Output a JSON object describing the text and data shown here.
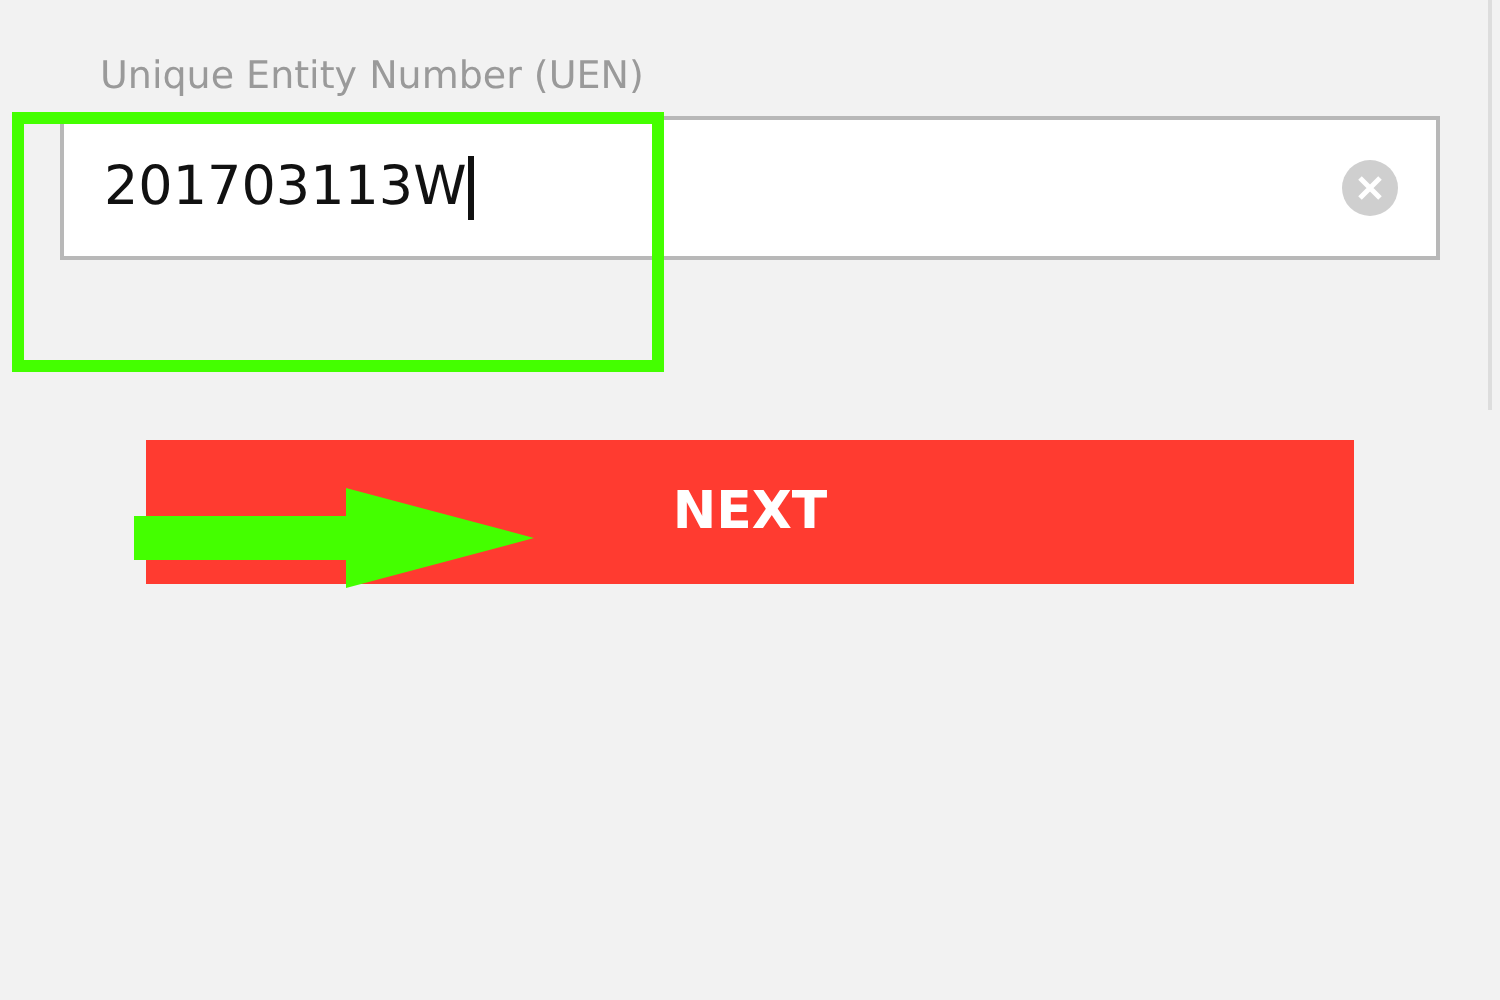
{
  "uen_field": {
    "label": "Unique Entity Number (UEN)",
    "value": "201703113W",
    "focused": true
  },
  "next_button": {
    "label": "NEXT"
  },
  "annotations": [
    {
      "kind": "box"
    },
    {
      "kind": "arrow"
    }
  ]
}
